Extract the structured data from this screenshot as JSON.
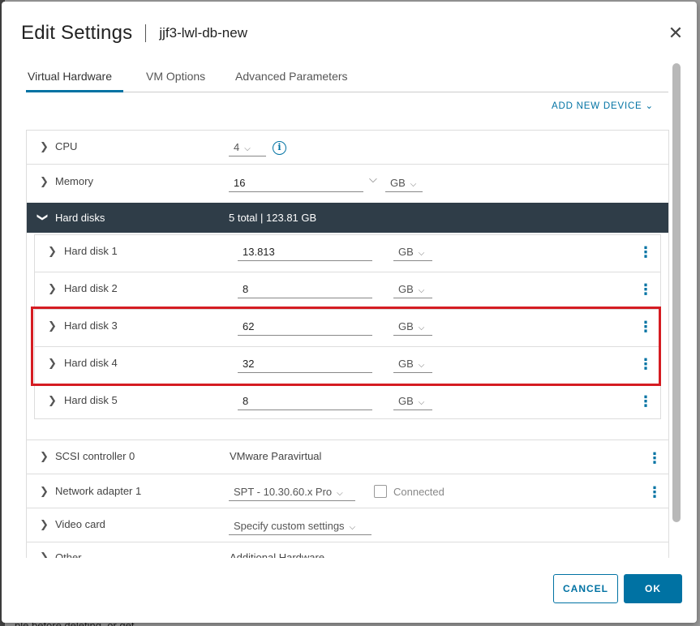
{
  "window": {
    "title": "Edit Settings",
    "vm_name": "jjf3-lwl-db-new",
    "close_glyph": "✕"
  },
  "tabs": [
    {
      "label": "Virtual Hardware",
      "active": true
    },
    {
      "label": "VM Options",
      "active": false
    },
    {
      "label": "Advanced Parameters",
      "active": false
    }
  ],
  "add_new_device": "ADD NEW DEVICE ⌄",
  "hardware": {
    "cpu": {
      "label": "CPU",
      "value": "4"
    },
    "memory": {
      "label": "Memory",
      "value": "16",
      "unit": "GB"
    },
    "hard_disks": {
      "label": "Hard disks",
      "summary": "5 total | 123.81 GB",
      "disks": [
        {
          "label": "Hard disk 1",
          "value": "13.813",
          "unit": "GB"
        },
        {
          "label": "Hard disk 2",
          "value": "8",
          "unit": "GB"
        },
        {
          "label": "Hard disk 3",
          "value": "62",
          "unit": "GB"
        },
        {
          "label": "Hard disk 4",
          "value": "32",
          "unit": "GB"
        },
        {
          "label": "Hard disk 5",
          "value": "8",
          "unit": "GB"
        }
      ]
    },
    "scsi": {
      "label": "SCSI controller 0",
      "value": "VMware Paravirtual"
    },
    "network": {
      "label": "Network adapter 1",
      "value": "SPT - 10.30.60.x Pro",
      "connected_label": "Connected"
    },
    "video": {
      "label": "Video card",
      "value": "Specify custom settings"
    },
    "other": {
      "label": "Other",
      "value": "Additional Hardware"
    }
  },
  "buttons": {
    "cancel": "CANCEL",
    "ok": "OK"
  },
  "backdrop_text": "ple before deleting, or get",
  "colors": {
    "accent": "#0072a3",
    "header_dark": "#2f3d48",
    "highlight": "#d51c22"
  },
  "icons": [
    "chevron-right-icon",
    "chevron-down-icon",
    "info-icon",
    "more-vertical-icon",
    "close-icon"
  ]
}
